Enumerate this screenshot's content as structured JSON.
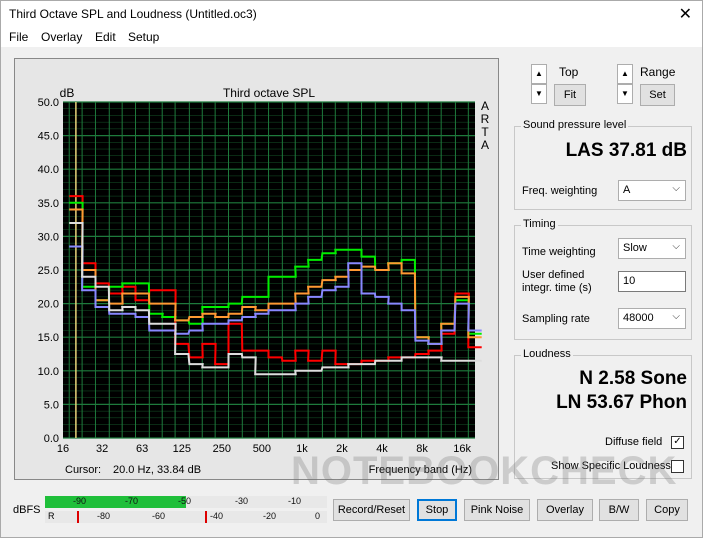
{
  "window": {
    "title": "Third Octave SPL and Loudness (Untitled.oc3)",
    "close_glyph": "✕"
  },
  "menu": [
    "File",
    "Overlay",
    "Edit",
    "Setup"
  ],
  "plot": {
    "cursor_label": "Cursor:",
    "cursor_value": "20.0 Hz, 33.84 dB"
  },
  "chart_data": {
    "type": "line",
    "title": "Third octave SPL",
    "ylabel": "dB",
    "xlabel": "Frequency band (Hz)",
    "corner_letters": [
      "A",
      "R",
      "T",
      "A"
    ],
    "x_ticks": [
      "16",
      "32",
      "63",
      "125",
      "250",
      "500",
      "1k",
      "2k",
      "4k",
      "8k",
      "16k"
    ],
    "y_ticks": [
      "50.0",
      "45.0",
      "40.0",
      "35.0",
      "30.0",
      "25.0",
      "20.0",
      "15.0",
      "10.0",
      "5.0",
      "0.0"
    ],
    "ylim": [
      0,
      50
    ],
    "bands_hz": [
      20,
      25,
      31.5,
      40,
      50,
      63,
      80,
      100,
      125,
      160,
      200,
      250,
      315,
      400,
      500,
      630,
      800,
      1000,
      1250,
      1600,
      2000,
      2500,
      3150,
      4000,
      5000,
      6300,
      8000,
      10000,
      12500,
      16000,
      20000
    ],
    "colors": {
      "background": "#000000",
      "grid": "#1e7a3c"
    },
    "series": [
      {
        "color": "#ff0000",
        "values": [
          36.0,
          26.0,
          23.0,
          21.5,
          22.5,
          20.5,
          22.0,
          22.0,
          14.0,
          12.0,
          14.0,
          11.0,
          17.0,
          13.0,
          13.0,
          12.0,
          11.5,
          13.0,
          11.5,
          13.0,
          11.0,
          11.0,
          11.5,
          11.5,
          12.0,
          12.0,
          12.5,
          13.0,
          15.5,
          21.5,
          13.5
        ]
      },
      {
        "color": "#00ee00",
        "values": [
          35.0,
          22.5,
          20.5,
          22.5,
          23.0,
          23.0,
          18.5,
          18.0,
          17.5,
          17.0,
          19.5,
          19.5,
          20.0,
          21.0,
          21.0,
          24.0,
          24.0,
          25.5,
          26.5,
          27.5,
          28.0,
          28.0,
          27.0,
          25.0,
          26.0,
          26.5,
          15.0,
          14.0,
          17.0,
          20.5,
          15.5
        ]
      },
      {
        "color": "#ff9933",
        "values": [
          34.0,
          25.0,
          20.5,
          20.0,
          21.5,
          21.5,
          20.0,
          20.0,
          17.5,
          18.0,
          18.5,
          18.0,
          18.5,
          19.5,
          19.0,
          20.0,
          20.0,
          21.5,
          22.5,
          23.5,
          24.0,
          25.0,
          25.5,
          25.0,
          26.0,
          24.5,
          15.0,
          14.0,
          17.0,
          21.0,
          15.0
        ]
      },
      {
        "color": "#8888ff",
        "values": [
          28.5,
          22.0,
          19.5,
          18.5,
          18.5,
          18.0,
          16.0,
          16.0,
          15.5,
          16.0,
          17.0,
          17.0,
          17.5,
          18.0,
          18.5,
          19.0,
          19.0,
          20.0,
          21.0,
          22.0,
          22.5,
          26.0,
          21.5,
          21.0,
          20.0,
          19.0,
          14.5,
          14.0,
          16.0,
          20.0,
          16.0
        ]
      },
      {
        "color": "#dddddd",
        "values": [
          32.0,
          24.0,
          22.5,
          19.0,
          19.5,
          19.0,
          17.0,
          17.0,
          12.5,
          11.0,
          10.5,
          10.5,
          12.5,
          12.0,
          9.5,
          9.5,
          9.5,
          10.0,
          10.0,
          10.5,
          10.5,
          11.0,
          11.0,
          11.5,
          11.5,
          12.0,
          12.0,
          12.0,
          11.5,
          11.5,
          11.5
        ]
      }
    ]
  },
  "controls": {
    "top_label": "Top",
    "fit_label": "Fit",
    "range_label": "Range",
    "set_label": "Set",
    "up_glyph": "▲",
    "down_glyph": "▼",
    "combo_arrow": "⌵"
  },
  "spl": {
    "group_label": "Sound pressure level",
    "value": "LAS 37.81 dB",
    "freq_weighting_label": "Freq. weighting",
    "freq_weighting_value": "A"
  },
  "timing": {
    "group_label": "Timing",
    "time_weighting_label": "Time weighting",
    "time_weighting_value": "Slow",
    "user_time_label_1": "User defined",
    "user_time_label_2": "integr. time (s)",
    "user_time_value": "10",
    "sampling_rate_label": "Sampling rate",
    "sampling_rate_value": "48000"
  },
  "loudness": {
    "group_label": "Loudness",
    "sone_value": "N 2.58 Sone",
    "phon_value": "LN 53.67 Phon",
    "diffuse_label": "Diffuse field",
    "diffuse_checked": "✓",
    "specific_label": "Show Specific Loudness"
  },
  "meter": {
    "label": "dBFS",
    "row1_ticks": [
      "-90",
      "-70",
      "-50",
      "-30",
      "-10"
    ],
    "row2_ticks": [
      "R",
      "-80",
      "-60",
      "-40",
      "-20",
      "0"
    ],
    "row1_level": 0.5,
    "row2_level": 0.0,
    "colors": {
      "fill": "#1fbf3a",
      "peak": "#dd0000"
    }
  },
  "buttons": {
    "record": "Record/Reset",
    "stop": "Stop",
    "pink": "Pink Noise",
    "overlay": "Overlay",
    "bw": "B/W",
    "copy": "Copy"
  },
  "watermark": "NOTEBOOKCHECK"
}
